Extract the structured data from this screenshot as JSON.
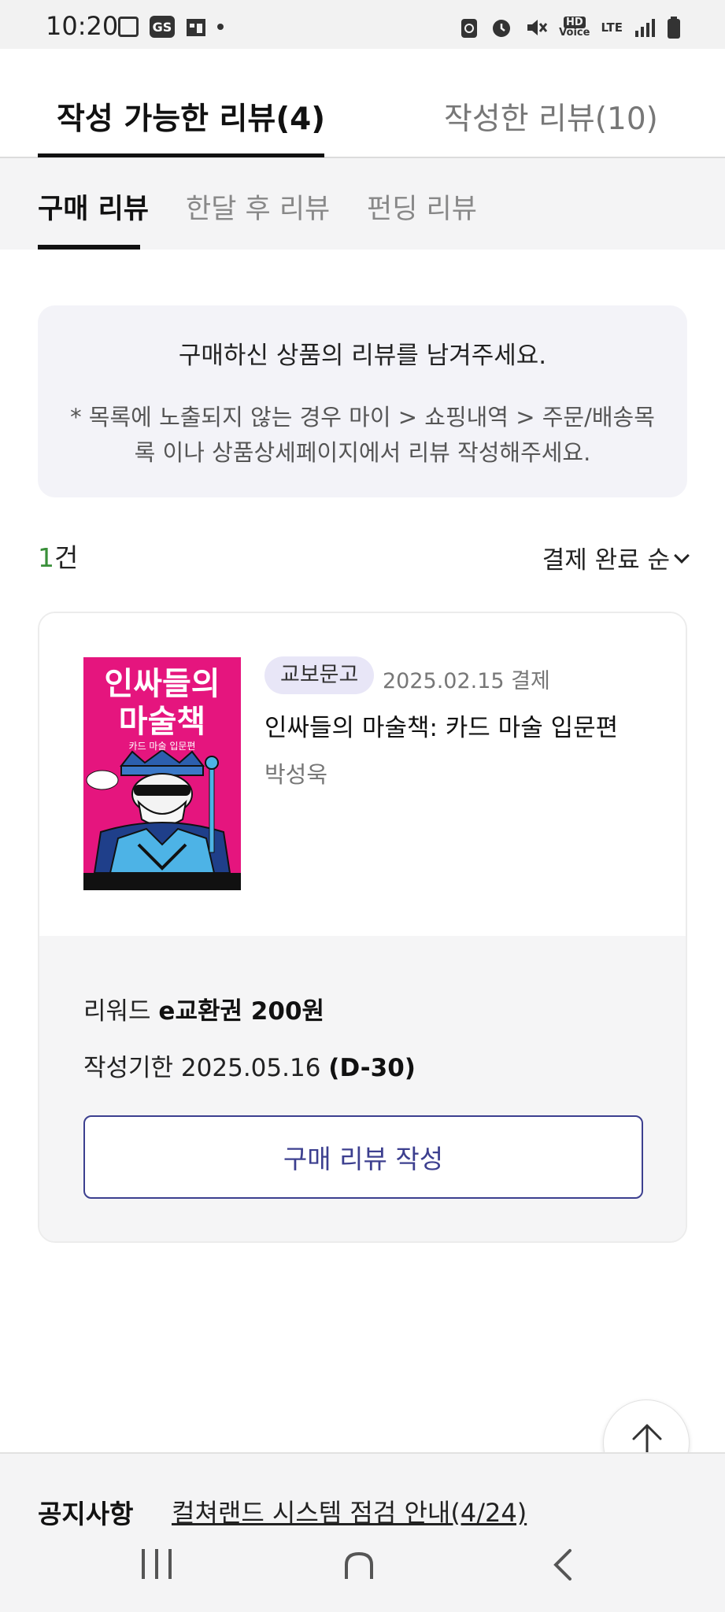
{
  "status_bar": {
    "time": "10:20",
    "carrier_badge": "GS",
    "hd_voice": "HD\nVoice",
    "network": "LTE",
    "icons": [
      "gallery-icon",
      "gs-app-icon",
      "calendar-icon",
      "notification-dot-icon",
      "recycle-icon",
      "alarm-icon",
      "mute-icon",
      "hd-voice-icon",
      "lte-icon",
      "signal-icon",
      "battery-icon"
    ]
  },
  "main_tabs": [
    {
      "label": "작성 가능한 리뷰(4)",
      "active": true
    },
    {
      "label": "작성한 리뷰(10)",
      "active": false
    }
  ],
  "sub_tabs": [
    {
      "label": "구매 리뷰",
      "active": true
    },
    {
      "label": "한달 후 리뷰",
      "active": false
    },
    {
      "label": "펀딩 리뷰",
      "active": false
    }
  ],
  "notice": {
    "title": "구매하신 상품의 리뷰를 남겨주세요.",
    "description": "* 목록에 노출되지 않는 경우 마이 > 쇼핑내역 > 주문/배송목록 이나 상품상세페이지에서 리뷰 작성해주세요."
  },
  "list_header": {
    "count_number": "1",
    "count_unit": "건",
    "sort_label": "결제 완료 순"
  },
  "review_card": {
    "cover": {
      "title_line1": "인싸들의",
      "title_line2": "마술책",
      "subtitle": "카드 마술 입문편"
    },
    "badge": "교보문고",
    "paid_date": "2025.02.15 결제",
    "book_title": "인싸들의 마술책: 카드 마술 입문편",
    "author": "박성욱",
    "reward_label": "리워드",
    "reward_value": "e교환권 200원",
    "deadline_label": "작성기한 2025.05.16",
    "deadline_dday": "(D-30)",
    "write_button": "구매 리뷰 작성"
  },
  "footer_notice": {
    "label": "공지사항",
    "link": "컬쳐랜드 시스템 점검 안내(4/24)"
  }
}
